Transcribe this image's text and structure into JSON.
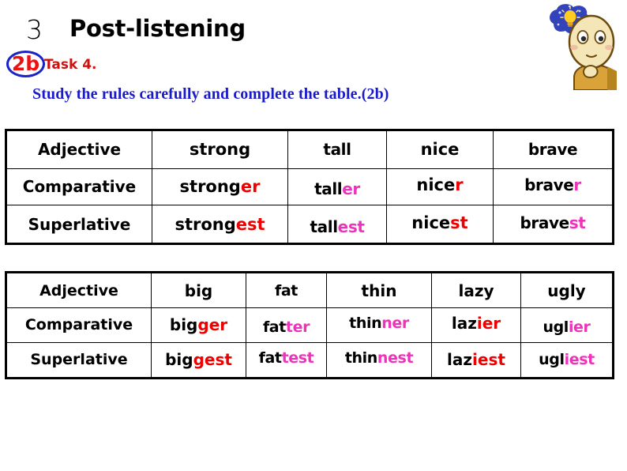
{
  "header": {
    "section_number": "3",
    "title": "Post-listening",
    "badge": "2b",
    "task_label": "Task 4.",
    "instruction": "Study the rules carefully and complete the table.(2b)",
    "badge_ring_color": "#1a23c4",
    "badge_text_color": "#ee1111",
    "task_color": "#cc1111",
    "instruction_color": "#1a1acc"
  },
  "cartoon": {
    "name": "thinking-character",
    "bubble_color": "#3344bb",
    "bulb_color": "#ffcc22",
    "skin_color": "#f5e6b8",
    "shirt_color": "#d9a33a"
  },
  "colors": {
    "suffix_red": "#ee0000",
    "suffix_magenta": "#ee33bb",
    "border": "#000000"
  },
  "table_one": {
    "row_labels": [
      "Adjective",
      "Comparative",
      "Superlative"
    ],
    "columns": [
      {
        "adjective": "strong",
        "style": "std",
        "suffix_color": "red",
        "comparative_stem": "strong",
        "comparative_suffix": "er",
        "superlative_stem": "strong",
        "superlative_suffix": "est"
      },
      {
        "adjective": "tall",
        "style": "round",
        "suffix_color": "magenta",
        "comparative_stem": "tall",
        "comparative_suffix": "er",
        "superlative_stem": "tall",
        "superlative_suffix": "est"
      },
      {
        "adjective": "nice",
        "style": "std",
        "suffix_color": "red",
        "comparative_stem": "nice",
        "comparative_suffix": "r",
        "superlative_stem": "nice",
        "superlative_suffix": "st"
      },
      {
        "adjective": "brave",
        "style": "round",
        "suffix_color": "magenta",
        "comparative_stem": "brave",
        "comparative_suffix": "r",
        "superlative_stem": "brave",
        "superlative_suffix": "st"
      }
    ]
  },
  "table_two": {
    "row_labels": [
      "Adjective",
      "Comparative",
      "Superlative"
    ],
    "columns": [
      {
        "adjective": "big",
        "style": "std",
        "suffix_color": "red",
        "comparative_stem": "big",
        "comparative_suffix": "ger",
        "superlative_stem": "big",
        "superlative_suffix": "gest"
      },
      {
        "adjective": "fat",
        "style": "round",
        "suffix_color": "magenta",
        "comparative_stem": "fat",
        "comparative_suffix": "ter",
        "superlative_stem": "fat",
        "superlative_suffix": "test"
      },
      {
        "adjective": "thin",
        "style": "round",
        "suffix_color": "magenta",
        "comparative_stem": "thin",
        "comparative_suffix": "ner",
        "superlative_stem": "thin",
        "superlative_suffix": "nest"
      },
      {
        "adjective": "lazy",
        "style": "std",
        "suffix_color": "red",
        "comparative_stem": "laz",
        "comparative_suffix": "ier",
        "superlative_stem": "laz",
        "superlative_suffix": "iest"
      },
      {
        "adjective": "ugly",
        "style": "round",
        "suffix_color": "magenta",
        "comparative_stem": "ugl",
        "comparative_suffix": "ier",
        "superlative_stem": "ugl",
        "superlative_suffix": "iest"
      }
    ]
  }
}
